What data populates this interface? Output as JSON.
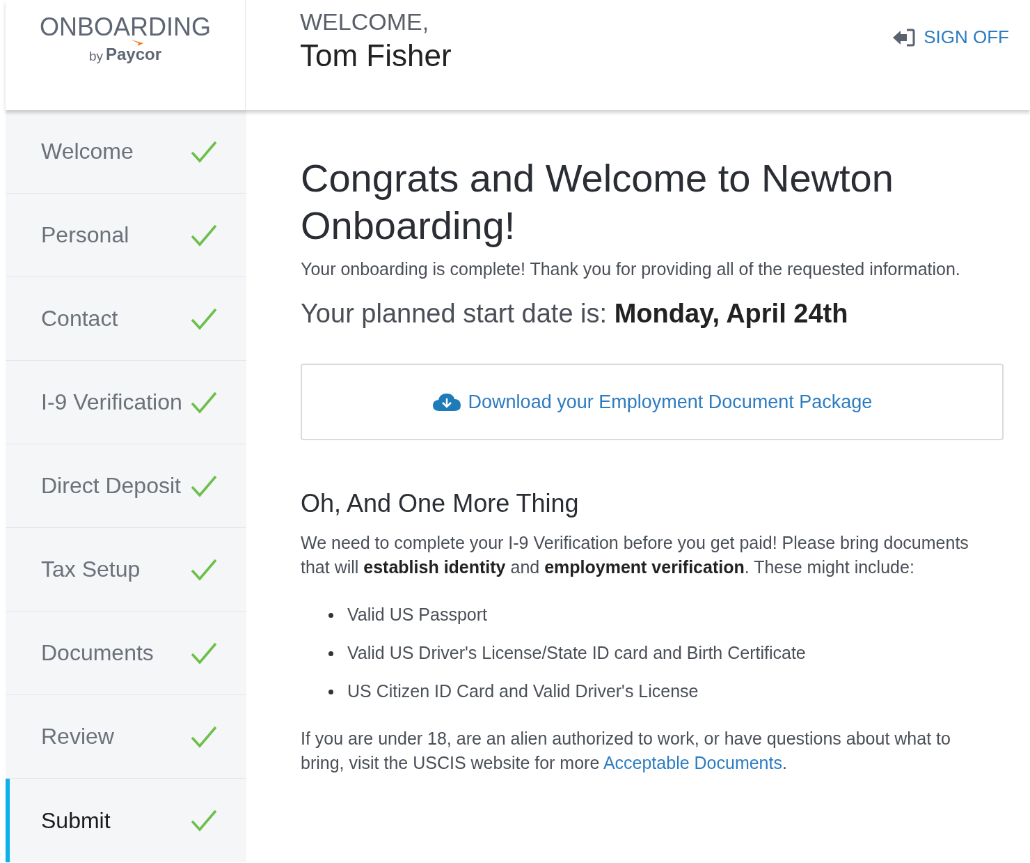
{
  "logo": {
    "title": "ONBOARDING",
    "by": "by",
    "brand": "Paycor"
  },
  "header": {
    "greeting": "WELCOME,",
    "name": "Tom Fisher",
    "sign_off": "SIGN OFF"
  },
  "sidebar": {
    "items": [
      {
        "label": "Welcome",
        "completed": true,
        "selected": false
      },
      {
        "label": "Personal",
        "completed": true,
        "selected": false
      },
      {
        "label": "Contact",
        "completed": true,
        "selected": false
      },
      {
        "label": "I-9 Verification",
        "completed": true,
        "selected": false
      },
      {
        "label": "Direct Deposit",
        "completed": true,
        "selected": false
      },
      {
        "label": "Tax Setup",
        "completed": true,
        "selected": false
      },
      {
        "label": "Documents",
        "completed": true,
        "selected": false
      },
      {
        "label": "Review",
        "completed": true,
        "selected": false
      },
      {
        "label": "Submit",
        "completed": true,
        "selected": true
      }
    ]
  },
  "main": {
    "title": "Congrats and Welcome to Newton Onboarding!",
    "intro": "Your onboarding is complete! Thank you for providing all of the requested information.",
    "start_date": "Your planned start date is: **Monday, April 24th**",
    "download_button": "Download your Employment Document Package",
    "subtitle": "Oh, And One More Thing",
    "note": "We need to complete your I-9 Verification before you get paid! Please bring documents that will **establish identity** and **employment verification**. These might include:",
    "documents": [
      "Valid US Passport",
      "Valid US Driver's License/State ID card and Birth Certificate",
      "US Citizen ID Card and Valid Driver's License"
    ],
    "footer_text": "If you are under 18, are an alien authorized to work, or have questions about what to bring, visit the USCIS website for more",
    "footer_link": "Acceptable Documents",
    "footer_end": "."
  }
}
